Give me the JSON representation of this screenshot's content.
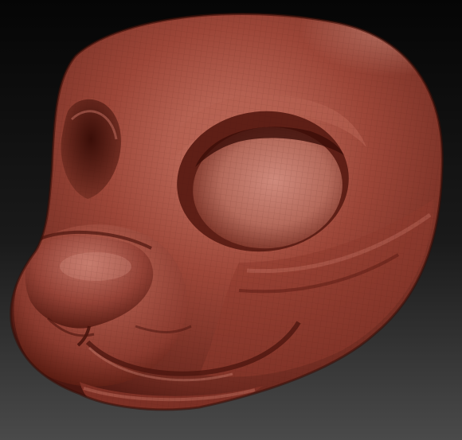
{
  "viewport": {
    "background_top": "#050505",
    "background_bottom": "#4a4a4a"
  },
  "model": {
    "subject": "sculpted-animal-head",
    "material_color": "#9c4638",
    "material_highlight": "#c97766",
    "material_shadow": "#4a1610",
    "wireframe_visible": true
  }
}
